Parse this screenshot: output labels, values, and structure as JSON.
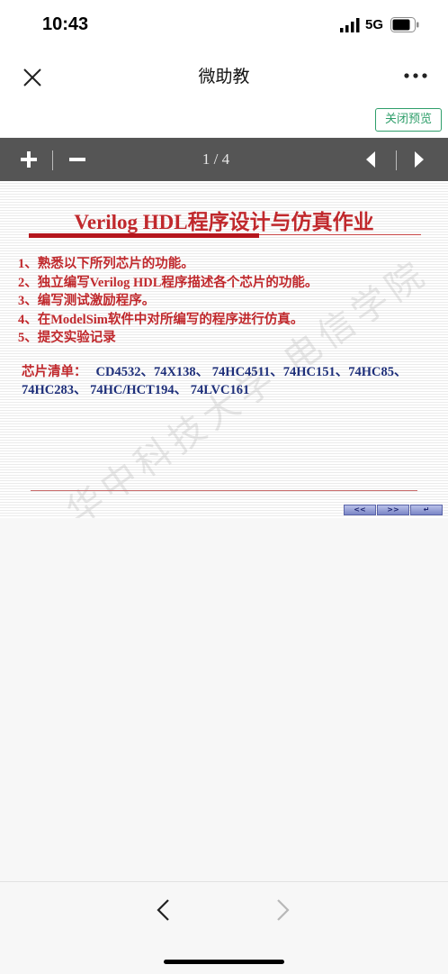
{
  "status_bar": {
    "time": "10:43",
    "network": "5G"
  },
  "nav": {
    "title": "微助教"
  },
  "preview": {
    "close_label": "关闭预览"
  },
  "toolbar": {
    "page_indicator": "1 / 4"
  },
  "slide": {
    "title": "Verilog HDL程序设计与仿真作业",
    "tasks": [
      "1、熟悉以下所列芯片的功能。",
      "2、独立编写Verilog HDL程序描述各个芯片的功能。",
      "3、编写测试激励程序。",
      "4、在ModelSim软件中对所编写的程序进行仿真。",
      "5、提交实验记录"
    ],
    "chip_label": "芯片清单：",
    "chip_list": "CD4532、74X138、 74HC4511、74HC151、74HC85、74HC283、 74HC/HCT194、 74LVC161",
    "watermark": "华中科技大学 电信学院",
    "nav_buttons": [
      "<<",
      ">>",
      "↵"
    ]
  },
  "colors": {
    "accent_green": "#2e9e6a",
    "toolbar_bg": "#555555",
    "slide_red": "#c0282c",
    "slide_blue": "#1e2f7a"
  }
}
